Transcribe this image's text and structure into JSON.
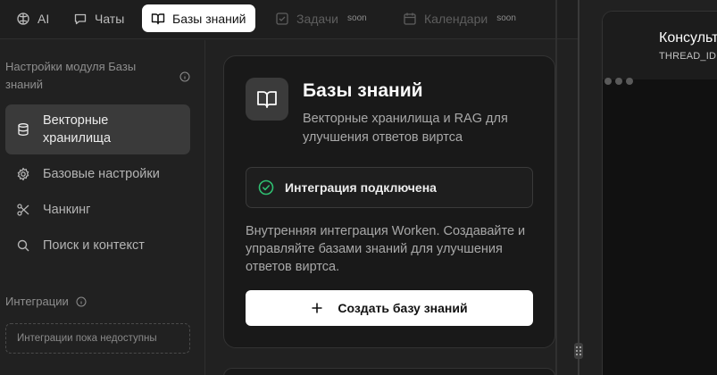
{
  "tabs": [
    {
      "label": "AI",
      "icon": "brain-icon"
    },
    {
      "label": "Чаты",
      "icon": "chat-icon"
    },
    {
      "label": "Базы знаний",
      "icon": "book-open-icon"
    },
    {
      "label": "Задачи",
      "icon": "checkbox-icon",
      "badge": "soon"
    },
    {
      "label": "Календари",
      "icon": "calendar-icon",
      "badge": "soon"
    }
  ],
  "active_tab": "Базы знаний",
  "sidebar": {
    "heading": "Настройки модуля Базы знаний",
    "items": [
      {
        "label": "Векторные хранилища",
        "icon": "database-icon",
        "active": true
      },
      {
        "label": "Базовые настройки",
        "icon": "gear-icon"
      },
      {
        "label": "Чанкинг",
        "icon": "scissors-icon"
      },
      {
        "label": "Поиск и контекст",
        "icon": "search-icon"
      }
    ],
    "integrations_heading": "Интеграции",
    "integrations_empty": "Интеграции пока недоступны"
  },
  "card": {
    "title": "Базы знаний",
    "subtitle": "Векторные хранилища и RAG для улучшения ответов виртса",
    "status": "Интеграция подключена",
    "description": "Внутренняя интеграция Worken. Создавайте и управляйте базами знаний для улучшения ответов виртса.",
    "create_button": "Создать базу знаний"
  },
  "right_panel": {
    "title": "Консульт",
    "subtitle": "THREAD_ID"
  },
  "colors": {
    "accent_success": "#2fbf71",
    "active_tab_bg": "#ffffff",
    "background": "#212121"
  }
}
